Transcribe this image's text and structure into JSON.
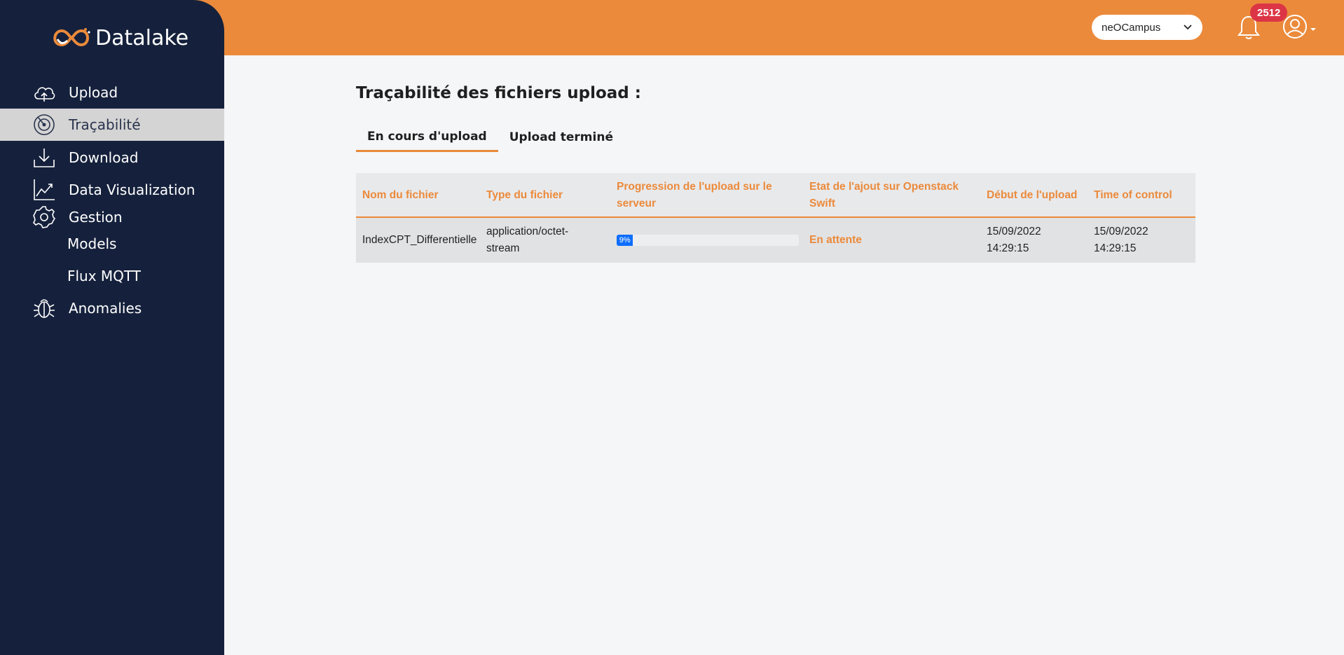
{
  "app": {
    "name": "Datalake"
  },
  "sidebar": {
    "items": [
      {
        "label": "Upload",
        "icon": "cloud-upload-icon"
      },
      {
        "label": "Traçabilité",
        "icon": "radar-icon",
        "active": true
      },
      {
        "label": "Download",
        "icon": "download-icon"
      },
      {
        "label": "Data Visualization",
        "icon": "chart-line-icon"
      },
      {
        "label": "Gestion",
        "icon": "gear-icon"
      },
      {
        "label": "Models",
        "sub": true
      },
      {
        "label": "Flux MQTT",
        "sub": true
      },
      {
        "label": "Anomalies",
        "icon": "bug-icon"
      }
    ]
  },
  "header": {
    "org_select": "neOCampus",
    "notifications_count": "2512"
  },
  "main": {
    "title": "Traçabilité des fichiers upload :",
    "tabs": [
      {
        "label": "En cours d'upload",
        "active": true
      },
      {
        "label": "Upload terminé"
      }
    ],
    "table": {
      "columns": [
        "Nom du fichier",
        "Type du fichier",
        "Progression de l'upload sur le serveur",
        "Etat de l'ajout sur Openstack Swift",
        "Début de l'upload",
        "Time of control"
      ],
      "rows": [
        {
          "name": "IndexCPT_Differentielle",
          "type": "application/octet-stream",
          "progress": 9,
          "progress_label": "9%",
          "status": "En attente",
          "start": "15/09/2022 14:29:15",
          "control": "15/09/2022 14:29:15"
        }
      ]
    }
  },
  "colors": {
    "accent": "#eb8a3b",
    "sidebar": "#15213c",
    "progress": "#0d6efd",
    "badge": "#dc3545"
  }
}
